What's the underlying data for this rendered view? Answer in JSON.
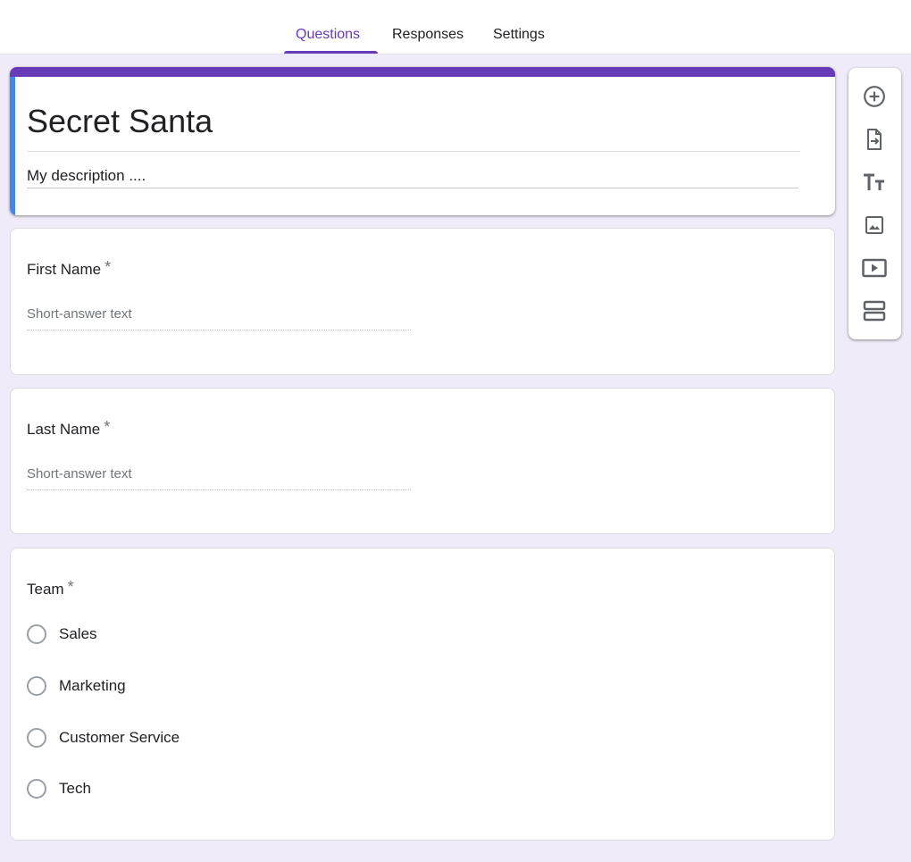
{
  "tabs": [
    {
      "label": "Questions",
      "active": true
    },
    {
      "label": "Responses",
      "active": false
    },
    {
      "label": "Settings",
      "active": false
    }
  ],
  "form": {
    "title": "Secret Santa",
    "description": "My description ...."
  },
  "questions": [
    {
      "label": "First Name",
      "required_mark": "*",
      "placeholder": "Short-answer text"
    },
    {
      "label": "Last Name",
      "required_mark": "*",
      "placeholder": "Short-answer text"
    },
    {
      "label": "Team",
      "required_mark": "*",
      "options": [
        "Sales",
        "Marketing",
        "Customer Service",
        "Tech"
      ]
    }
  ],
  "toolbar": {
    "items": [
      "add-question-icon",
      "import-questions-icon",
      "add-title-icon",
      "add-image-icon",
      "add-video-icon",
      "add-section-icon"
    ]
  },
  "colors": {
    "accent": "#673ab7",
    "header_left_bar": "#4285f4",
    "background": "#f0ebf8"
  }
}
